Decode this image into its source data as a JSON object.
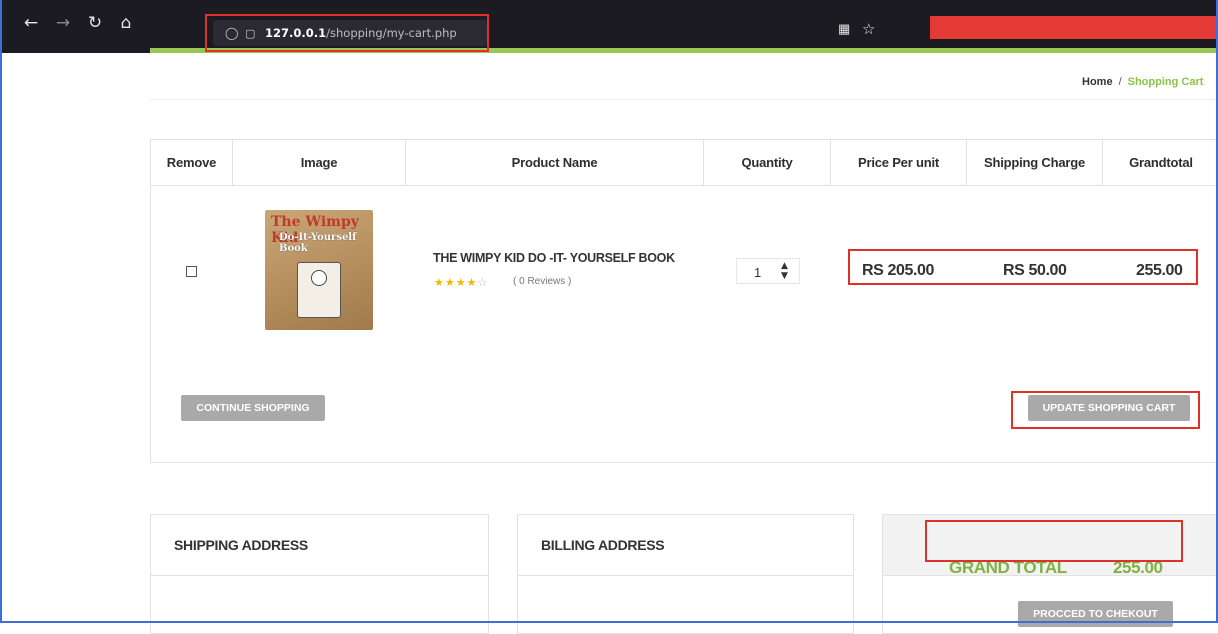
{
  "browser": {
    "url_host": "127.0.0.1",
    "url_path": "/shopping/my-cart.php"
  },
  "breadcrumb": {
    "home": "Home",
    "separator": "/",
    "current": "Shopping Cart"
  },
  "cart": {
    "headers": [
      "Remove",
      "Image",
      "Product Name",
      "Quantity",
      "Price Per unit",
      "Shipping Charge",
      "Grandtotal"
    ],
    "item": {
      "name": "THE WIMPY KID DO -IT- YOURSELF BOOK",
      "rating_stars": "★★★★",
      "rating_empty": "☆",
      "reviews": "( 0 Reviews )",
      "quantity": "1",
      "price": "RS 205.00",
      "shipping": "RS 50.00",
      "grandtotal": "255.00",
      "cover_title": "The Wimpy Kid",
      "cover_subtitle": "Do-It-Yourself Book"
    },
    "continue_label": "CONTINUE SHOPPING",
    "update_label": "UPDATE SHOPPING CART"
  },
  "panels": {
    "shipping_title": "SHIPPING ADDRESS",
    "billing_title": "BILLING ADDRESS",
    "grand_total_label": "GRAND TOTAL",
    "grand_total_value": "255.00",
    "checkout_label": "PROCCED TO CHEKOUT"
  },
  "colors": {
    "accent": "#8bc34a",
    "highlight_border": "#e0302a"
  }
}
